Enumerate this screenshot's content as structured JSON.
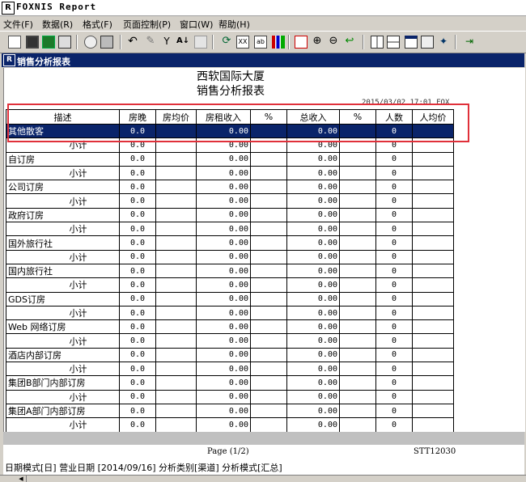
{
  "app": {
    "title": "FOXNIS Report",
    "logo": "R"
  },
  "menu": [
    "文件(F)",
    "数据(R)",
    "格式(F)",
    "页面控制(P)",
    "窗口(W)",
    "帮助(H)"
  ],
  "toolbar_icons": [
    "new-icon",
    "save-icon",
    "excel-icon",
    "export-icon",
    "preview-icon",
    "print-icon",
    "undo-icon",
    "edit-icon",
    "filter-icon",
    "sort-icon",
    "grid-icon",
    "refresh-icon",
    "calc-icon",
    "report-icon",
    "chart-icon",
    "copy-icon",
    "zoom-in-icon",
    "zoom-out-icon",
    "back-icon",
    "view1-icon",
    "view2-icon",
    "window-icon",
    "tree-icon",
    "run-icon",
    "exit-icon"
  ],
  "window": {
    "title": "销售分析报表",
    "logo": "R"
  },
  "report": {
    "company": "西软国际大厦",
    "name": "销售分析报表",
    "print_date": "2015/03/02 17:01 FOX",
    "columns": [
      "描述",
      "房晚",
      "房均价",
      "房租收入",
      "%",
      "总收入",
      "%",
      "人数",
      "人均价"
    ],
    "rows": [
      {
        "desc": "其他散客",
        "type": "group",
        "room_nights": "0.0",
        "adr": "",
        "room_rev": "0.00",
        "pct1": "",
        "total_rev": "0.00",
        "pct2": "",
        "persons": "0",
        "per_cap": ""
      },
      {
        "desc": "小计",
        "type": "subtotal",
        "room_nights": "0.0",
        "adr": "",
        "room_rev": "0.00",
        "pct1": "",
        "total_rev": "0.00",
        "pct2": "",
        "persons": "0",
        "per_cap": ""
      },
      {
        "desc": "自订房",
        "type": "group",
        "room_nights": "0.0",
        "adr": "",
        "room_rev": "0.00",
        "pct1": "",
        "total_rev": "0.00",
        "pct2": "",
        "persons": "0",
        "per_cap": ""
      },
      {
        "desc": "小计",
        "type": "subtotal",
        "room_nights": "0.0",
        "adr": "",
        "room_rev": "0.00",
        "pct1": "",
        "total_rev": "0.00",
        "pct2": "",
        "persons": "0",
        "per_cap": ""
      },
      {
        "desc": "公司订房",
        "type": "group",
        "room_nights": "0.0",
        "adr": "",
        "room_rev": "0.00",
        "pct1": "",
        "total_rev": "0.00",
        "pct2": "",
        "persons": "0",
        "per_cap": ""
      },
      {
        "desc": "小计",
        "type": "subtotal",
        "room_nights": "0.0",
        "adr": "",
        "room_rev": "0.00",
        "pct1": "",
        "total_rev": "0.00",
        "pct2": "",
        "persons": "0",
        "per_cap": ""
      },
      {
        "desc": "政府订房",
        "type": "group",
        "room_nights": "0.0",
        "adr": "",
        "room_rev": "0.00",
        "pct1": "",
        "total_rev": "0.00",
        "pct2": "",
        "persons": "0",
        "per_cap": ""
      },
      {
        "desc": "小计",
        "type": "subtotal",
        "room_nights": "0.0",
        "adr": "",
        "room_rev": "0.00",
        "pct1": "",
        "total_rev": "0.00",
        "pct2": "",
        "persons": "0",
        "per_cap": ""
      },
      {
        "desc": "国外旅行社",
        "type": "group",
        "room_nights": "0.0",
        "adr": "",
        "room_rev": "0.00",
        "pct1": "",
        "total_rev": "0.00",
        "pct2": "",
        "persons": "0",
        "per_cap": ""
      },
      {
        "desc": "小计",
        "type": "subtotal",
        "room_nights": "0.0",
        "adr": "",
        "room_rev": "0.00",
        "pct1": "",
        "total_rev": "0.00",
        "pct2": "",
        "persons": "0",
        "per_cap": ""
      },
      {
        "desc": "国内旅行社",
        "type": "group",
        "room_nights": "0.0",
        "adr": "",
        "room_rev": "0.00",
        "pct1": "",
        "total_rev": "0.00",
        "pct2": "",
        "persons": "0",
        "per_cap": ""
      },
      {
        "desc": "小计",
        "type": "subtotal",
        "room_nights": "0.0",
        "adr": "",
        "room_rev": "0.00",
        "pct1": "",
        "total_rev": "0.00",
        "pct2": "",
        "persons": "0",
        "per_cap": ""
      },
      {
        "desc": "GDS订房",
        "type": "group",
        "room_nights": "0.0",
        "adr": "",
        "room_rev": "0.00",
        "pct1": "",
        "total_rev": "0.00",
        "pct2": "",
        "persons": "0",
        "per_cap": ""
      },
      {
        "desc": "小计",
        "type": "subtotal",
        "room_nights": "0.0",
        "adr": "",
        "room_rev": "0.00",
        "pct1": "",
        "total_rev": "0.00",
        "pct2": "",
        "persons": "0",
        "per_cap": ""
      },
      {
        "desc": "Web 网络订房",
        "type": "group",
        "room_nights": "0.0",
        "adr": "",
        "room_rev": "0.00",
        "pct1": "",
        "total_rev": "0.00",
        "pct2": "",
        "persons": "0",
        "per_cap": ""
      },
      {
        "desc": "小计",
        "type": "subtotal",
        "room_nights": "0.0",
        "adr": "",
        "room_rev": "0.00",
        "pct1": "",
        "total_rev": "0.00",
        "pct2": "",
        "persons": "0",
        "per_cap": ""
      },
      {
        "desc": "酒店内部订房",
        "type": "group",
        "room_nights": "0.0",
        "adr": "",
        "room_rev": "0.00",
        "pct1": "",
        "total_rev": "0.00",
        "pct2": "",
        "persons": "0",
        "per_cap": ""
      },
      {
        "desc": "小计",
        "type": "subtotal",
        "room_nights": "0.0",
        "adr": "",
        "room_rev": "0.00",
        "pct1": "",
        "total_rev": "0.00",
        "pct2": "",
        "persons": "0",
        "per_cap": ""
      },
      {
        "desc": "集团B部门内部订房",
        "type": "group",
        "room_nights": "0.0",
        "adr": "",
        "room_rev": "0.00",
        "pct1": "",
        "total_rev": "0.00",
        "pct2": "",
        "persons": "0",
        "per_cap": ""
      },
      {
        "desc": "小计",
        "type": "subtotal",
        "room_nights": "0.0",
        "adr": "",
        "room_rev": "0.00",
        "pct1": "",
        "total_rev": "0.00",
        "pct2": "",
        "persons": "0",
        "per_cap": ""
      },
      {
        "desc": "集团A部门内部订房",
        "type": "group",
        "room_nights": "0.0",
        "adr": "",
        "room_rev": "0.00",
        "pct1": "",
        "total_rev": "0.00",
        "pct2": "",
        "persons": "0",
        "per_cap": ""
      },
      {
        "desc": "小计",
        "type": "subtotal",
        "room_nights": "0.0",
        "adr": "",
        "room_rev": "0.00",
        "pct1": "",
        "total_rev": "0.00",
        "pct2": "",
        "persons": "0",
        "per_cap": ""
      }
    ],
    "page": "Page (1/2)",
    "report_id": "STT12030"
  },
  "status": "日期模式[日] 营业日期 [2014/09/16]  分析类别[渠道] 分析模式[汇总]",
  "colors": {
    "selection": "#0a246a",
    "highlight_box": "#e0303a"
  }
}
